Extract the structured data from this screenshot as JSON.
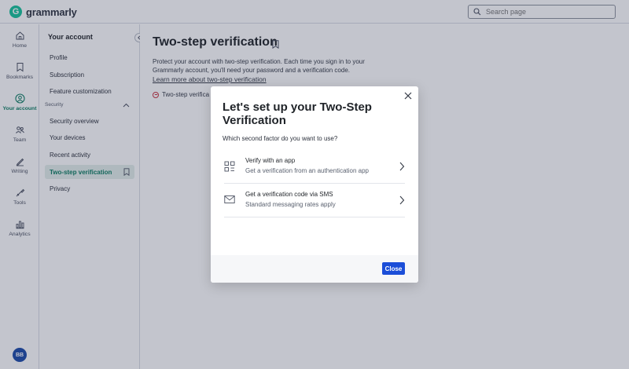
{
  "app": {
    "brand": "grammarly"
  },
  "search": {
    "placeholder": "Search page"
  },
  "rail": {
    "items": [
      {
        "label": "Home",
        "icon": "home-icon"
      },
      {
        "label": "Bookmarks",
        "icon": "bookmark-icon"
      },
      {
        "label": "Your account",
        "icon": "account-icon",
        "active": true
      },
      {
        "label": "Team",
        "icon": "team-icon"
      },
      {
        "label": "Writing",
        "icon": "pen-icon"
      },
      {
        "label": "Tools",
        "icon": "tools-icon"
      },
      {
        "label": "Analytics",
        "icon": "analytics-icon"
      }
    ],
    "avatar_initials": "BB"
  },
  "sidebar": {
    "title": "Your account",
    "items": [
      {
        "label": "Profile"
      },
      {
        "label": "Subscription"
      },
      {
        "label": "Feature customization"
      }
    ],
    "section_label": "Security",
    "security_items": [
      {
        "label": "Security overview"
      },
      {
        "label": "Your devices"
      },
      {
        "label": "Recent activity"
      },
      {
        "label": "Two-step verification",
        "active": true
      },
      {
        "label": "Privacy"
      }
    ]
  },
  "main": {
    "title": "Two-step verification",
    "description": "Protect your account with two-step verification. Each time you sign in to your Grammarly account, you'll need your password and a verification code.",
    "learn_more": "Learn more about two-step verification",
    "status_text": "Two-step verifica"
  },
  "modal": {
    "title": "Let's set up your Two-Step Verification",
    "subtitle": "Which second factor do you want to use?",
    "options": [
      {
        "title": "Verify with an app",
        "description": "Get a verification from an authentication app",
        "icon": "qr-code-icon"
      },
      {
        "title": "Get a verification code via SMS",
        "description": "Standard messaging rates apply",
        "icon": "envelope-icon"
      }
    ],
    "close_label": "Close"
  },
  "colors": {
    "brand": "#15c39a",
    "accent_active": "#0d7d62",
    "primary_button": "#1b4ed8",
    "status_error": "#c8333f"
  }
}
